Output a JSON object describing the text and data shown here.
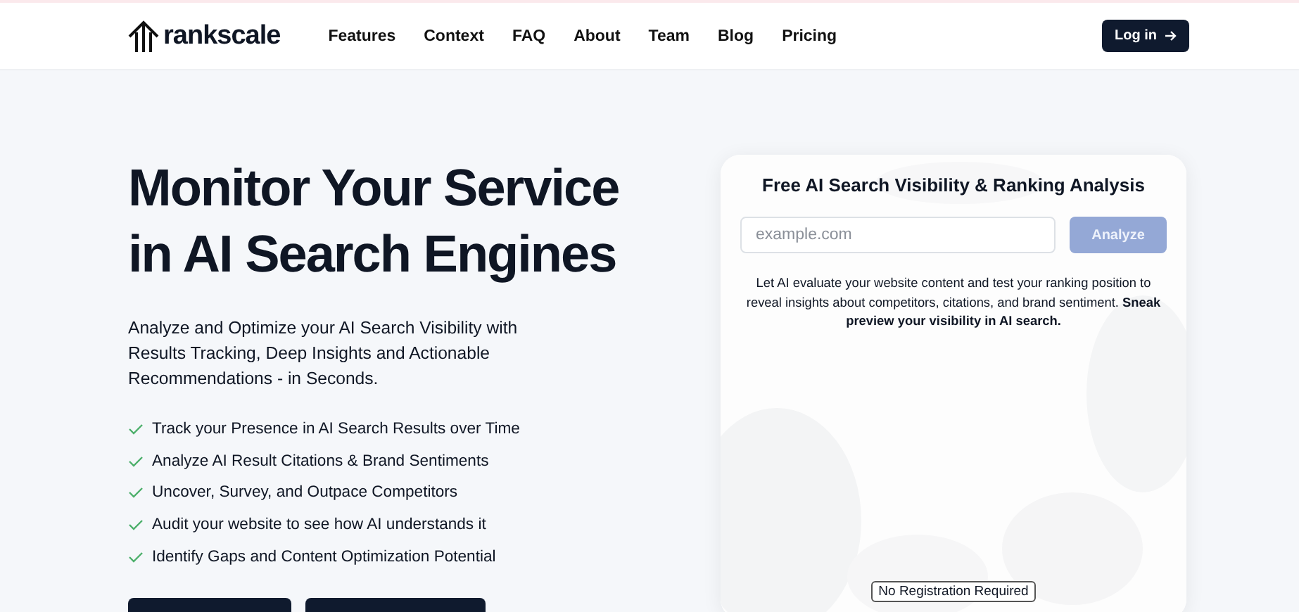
{
  "header": {
    "logo": "rankscale",
    "nav": [
      {
        "label": "Features"
      },
      {
        "label": "Context"
      },
      {
        "label": "FAQ"
      },
      {
        "label": "About"
      },
      {
        "label": "Team"
      },
      {
        "label": "Blog"
      },
      {
        "label": "Pricing"
      }
    ],
    "login": "Log in"
  },
  "hero": {
    "title": "Monitor Your Service in AI Search Engines",
    "subtitle": "Analyze and Optimize your AI Search Visibility with Results Tracking, Deep Insights and Actionable Recommendations - in Seconds.",
    "features": [
      "Track your Presence in AI Search Results over Time",
      "Analyze AI Result Citations & Brand Sentiments",
      "Uncover, Survey, and Outpace Competitors",
      "Audit your website to see how AI understands it",
      "Identify Gaps and Content Optimization Potential"
    ]
  },
  "card": {
    "title": "Free AI Search Visibility & Ranking Analysis",
    "url_field": {
      "placeholder": "example.com"
    },
    "button": "Analyze",
    "description": "Let AI evaluate your website content and test your ranking position to reveal insights about competitors, citations, and brand sentiment. **Sneak preview your visibility in AI search.**",
    "badge": "No Registration Required"
  }
}
